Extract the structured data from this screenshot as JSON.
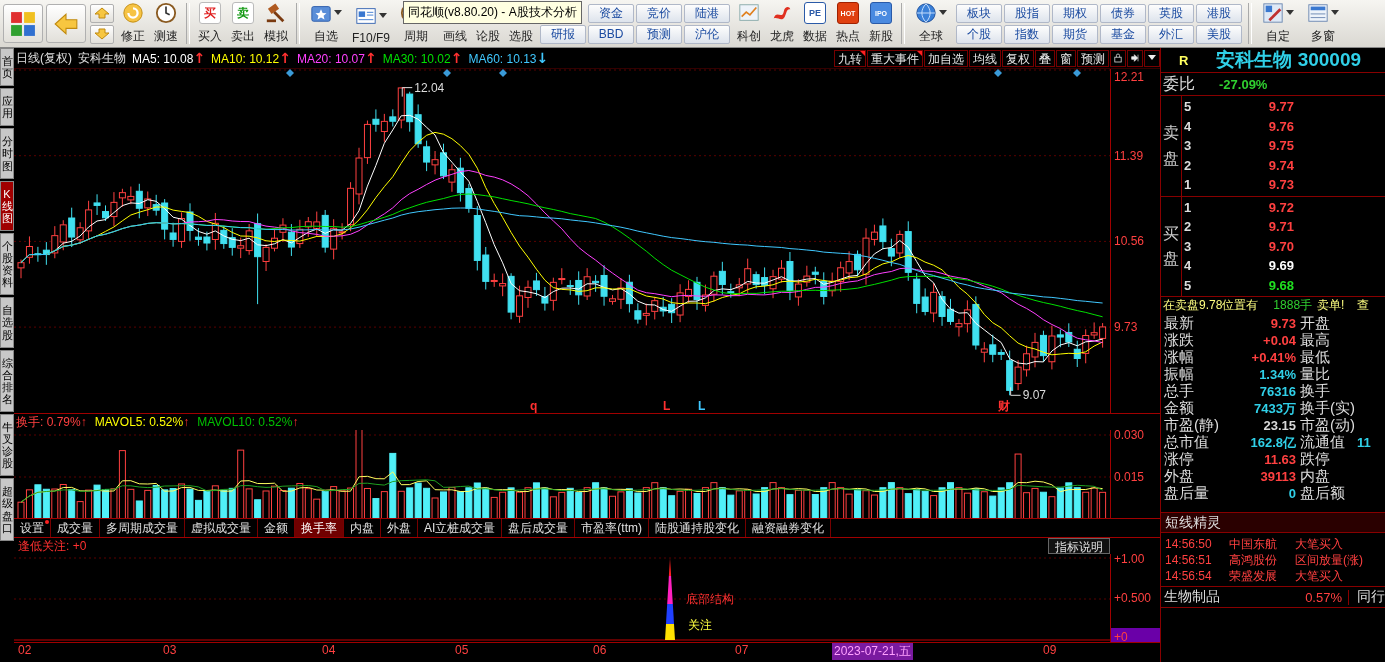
{
  "toolbar": [
    {
      "kind": "tile"
    },
    {
      "kind": "back"
    },
    {
      "kind": "updown"
    },
    {
      "kind": "tool",
      "label": "修正",
      "menu": false
    },
    {
      "kind": "tool",
      "label": "测速",
      "menu": false
    },
    {
      "kind": "sep"
    },
    {
      "kind": "tool",
      "label": "买入",
      "glyph": "买",
      "menu": false
    },
    {
      "kind": "tool",
      "label": "卖出",
      "glyph": "卖",
      "menu": false
    },
    {
      "kind": "tool",
      "label": "模拟",
      "menu": false
    },
    {
      "kind": "sep"
    },
    {
      "kind": "tool",
      "label": "自选",
      "menu": true
    },
    {
      "kind": "tool",
      "label": "F10/F9",
      "menu": true
    },
    {
      "kind": "tool",
      "label": "周期",
      "menu": true
    },
    {
      "kind": "tool",
      "label": "画线",
      "menu": false
    },
    {
      "kind": "tool",
      "label": "论股",
      "menu": false
    },
    {
      "kind": "tool",
      "label": "选股",
      "menu": false
    },
    {
      "kind": "grid",
      "rows": [
        [
          "",
          "资金",
          "竞价",
          "陆港"
        ],
        [
          "研报",
          "BBD",
          "预测",
          "沪伦"
        ]
      ]
    },
    {
      "kind": "tool",
      "label": "科创",
      "menu": false
    },
    {
      "kind": "tool",
      "label": "龙虎",
      "menu": false
    },
    {
      "kind": "tool",
      "label": "数据",
      "glyph": "PE",
      "menu": false
    },
    {
      "kind": "tool",
      "label": "热点",
      "glyph": "HOT",
      "menu": false
    },
    {
      "kind": "tool",
      "label": "新股",
      "glyph": "IPO",
      "menu": false
    },
    {
      "kind": "sep"
    },
    {
      "kind": "tool",
      "label": "全球",
      "menu": true
    },
    {
      "kind": "grid",
      "rows": [
        [
          "板块",
          "股指",
          "期权",
          "债券",
          "英股",
          "港股"
        ],
        [
          "个股",
          "指数",
          "期货",
          "基金",
          "外汇",
          "美股"
        ]
      ]
    },
    {
      "kind": "sep"
    },
    {
      "kind": "tool",
      "label": "自定",
      "menu": true
    },
    {
      "kind": "tool",
      "label": "多窗",
      "menu": true
    }
  ],
  "tooltip": "同花顺(v8.80.20) - A股技术分析",
  "side_tabs": [
    {
      "label": "首页",
      "selected": false
    },
    {
      "label": "应用",
      "selected": false
    },
    {
      "label": "分时图",
      "selected": false
    },
    {
      "label": "K线图",
      "selected": true
    },
    {
      "label": "个股资料",
      "selected": false
    },
    {
      "label": "自选股",
      "selected": false
    },
    {
      "label": "综合排名",
      "selected": false
    },
    {
      "label": "牛叉诊股",
      "selected": false
    },
    {
      "label": "超级盘口",
      "selected": false
    }
  ],
  "chart_header": {
    "period": "日线(复权)",
    "stock": "安科生物",
    "ma": [
      {
        "label": "MA5: 10.08",
        "trend": {
          "text": "↑",
          "color": "#ff3030"
        },
        "color": "#ffffff"
      },
      {
        "label": "MA10: 10.12",
        "trend": {
          "text": "↑",
          "color": "#ff3030"
        },
        "color": "#ffff00"
      },
      {
        "label": "MA20: 10.07",
        "trend": {
          "text": "↑",
          "color": "#ff3030"
        },
        "color": "#ff40ff"
      },
      {
        "label": "MA30: 10.02",
        "trend": {
          "text": "↑",
          "color": "#ff3030"
        },
        "color": "#00e000"
      },
      {
        "label": "MA60: 10.13",
        "trend": {
          "text": "↓",
          "color": "#40c8ff"
        },
        "color": "#40c8ff"
      }
    ],
    "buttons": [
      {
        "label": "九转",
        "flag": true
      },
      {
        "label": "重大事件",
        "flag": true
      },
      {
        "label": "加自选",
        "flag": false
      },
      {
        "label": "均线",
        "flag": false
      },
      {
        "label": "复权",
        "flag": false
      },
      {
        "label": "叠",
        "flag": false
      },
      {
        "label": "窗",
        "flag": false
      },
      {
        "label": "预测",
        "flag": false
      }
    ]
  },
  "price_chart": {
    "axis": [
      "12.21",
      "11.39",
      "10.56",
      "9.73"
    ],
    "high_label": "12.04",
    "low_label": "9.07",
    "markers": [
      {
        "label": "q",
        "color": "#ff3030"
      },
      {
        "label": "L",
        "color": "#ff3030"
      },
      {
        "label": "L",
        "color": "#40c8ff"
      },
      {
        "label": "财",
        "color": "#ff3030"
      }
    ]
  },
  "volume": {
    "header": [
      {
        "label": "换手: 0.79%",
        "trend": "↑",
        "color": "#ff4040"
      },
      {
        "label": "MAVOL5: 0.52%",
        "trend": "↑",
        "color": "#ffff00"
      },
      {
        "label": "MAVOL10: 0.52%",
        "trend": "↑",
        "color": "#00c000"
      }
    ],
    "axis": [
      "0.030",
      "0.015"
    ]
  },
  "indicator_tabs": [
    {
      "label": "设置",
      "selected": false,
      "flag": true
    },
    {
      "label": "成交量",
      "selected": false,
      "flag": false
    },
    {
      "label": "多周期成交量",
      "selected": false,
      "flag": false
    },
    {
      "label": "虚拟成交量",
      "selected": false,
      "flag": false
    },
    {
      "label": "金额",
      "selected": false,
      "flag": false
    },
    {
      "label": "换手率",
      "selected": true,
      "flag": false
    },
    {
      "label": "内盘",
      "selected": false,
      "flag": false
    },
    {
      "label": "外盘",
      "selected": false,
      "flag": false
    },
    {
      "label": "AI立桩成交量",
      "selected": false,
      "flag": false
    },
    {
      "label": "盘后成交量",
      "selected": false,
      "flag": false
    },
    {
      "label": "市盈率(ttm)",
      "selected": false,
      "flag": false
    },
    {
      "label": "陆股通持股变化",
      "selected": false,
      "flag": false
    },
    {
      "label": "融资融券变化",
      "selected": false,
      "flag": false
    }
  ],
  "signal_pane": {
    "title": "逢低关注: +0",
    "help": "指标说明",
    "axis": [
      "+1.00",
      "+0.500",
      "+0"
    ],
    "labels": [
      "底部结构",
      "关注"
    ]
  },
  "date_axis": {
    "months": [
      "02",
      "03",
      "04",
      "05",
      "06",
      "07",
      "09"
    ],
    "cursor": "2023-07-21,五"
  },
  "quote": {
    "badge": "R",
    "title": "安科生物 300009",
    "ratio_label": "委比",
    "ratio": "-27.09%",
    "sell_label": "卖盘",
    "buy_label": "买盘",
    "asks": [
      {
        "level": "5",
        "price": "9.77",
        "color": "#ff4040"
      },
      {
        "level": "4",
        "price": "9.76",
        "color": "#ff4040"
      },
      {
        "level": "3",
        "price": "9.75",
        "color": "#ff4040"
      },
      {
        "level": "2",
        "price": "9.74",
        "color": "#ff4040"
      },
      {
        "level": "1",
        "price": "9.73",
        "color": "#ff4040"
      }
    ],
    "bids": [
      {
        "level": "1",
        "price": "9.72",
        "color": "#ff4040"
      },
      {
        "level": "2",
        "price": "9.71",
        "color": "#ff4040"
      },
      {
        "level": "3",
        "price": "9.70",
        "color": "#ff4040"
      },
      {
        "level": "4",
        "price": "9.69",
        "color": "#ffffff"
      },
      {
        "level": "5",
        "price": "9.68",
        "color": "#20e020"
      }
    ],
    "notice": {
      "text": "在卖盘9.78位置有",
      "volume": "1888手",
      "tail": "卖单!",
      "cut": "查"
    },
    "stats": [
      {
        "label": "最新",
        "value": "9.73",
        "color": "#ff4040",
        "label2": "开盘"
      },
      {
        "label": "涨跌",
        "value": "+0.04",
        "color": "#ff4040",
        "label2": "最高"
      },
      {
        "label": "涨幅",
        "value": "+0.41%",
        "color": "#ff4040",
        "label2": "最低"
      },
      {
        "label": "振幅",
        "value": "1.34%",
        "color": "#30d0e8",
        "label2": "量比"
      },
      {
        "label": "总手",
        "value": "76316",
        "color": "#30d0e8",
        "label2": "换手"
      },
      {
        "label": "金额",
        "value": "7433万",
        "color": "#30d0e8",
        "label2": "换手(实)"
      },
      {
        "label": "市盈(静)",
        "value": "23.15",
        "color": "#d8d8d8",
        "label2": "市盈(动)"
      },
      {
        "label": "总市值",
        "value": "162.8亿",
        "color": "#30d0e8",
        "label2": "流通值",
        "value2": "11"
      },
      {
        "label": "涨停",
        "value": "11.63",
        "color": "#ff4040",
        "label2": "跌停"
      },
      {
        "label": "外盘",
        "value": "39113",
        "color": "#ff4040",
        "label2": "内盘"
      },
      {
        "label": "盘后量",
        "value": "0",
        "color": "#30d0e8",
        "label2": "盘后额"
      }
    ],
    "sprite": {
      "title": "短线精灵",
      "rows": [
        {
          "time": "14:56:50",
          "name": "中国东航",
          "event": "大笔买入"
        },
        {
          "time": "14:56:51",
          "name": "高鸿股份",
          "event": "区间放量(涨)"
        },
        {
          "time": "14:56:54",
          "name": "荣盛发展",
          "event": "大笔买入"
        }
      ]
    },
    "industry": {
      "name": "生物制品",
      "change": "0.57%",
      "peer": "同行"
    }
  }
}
